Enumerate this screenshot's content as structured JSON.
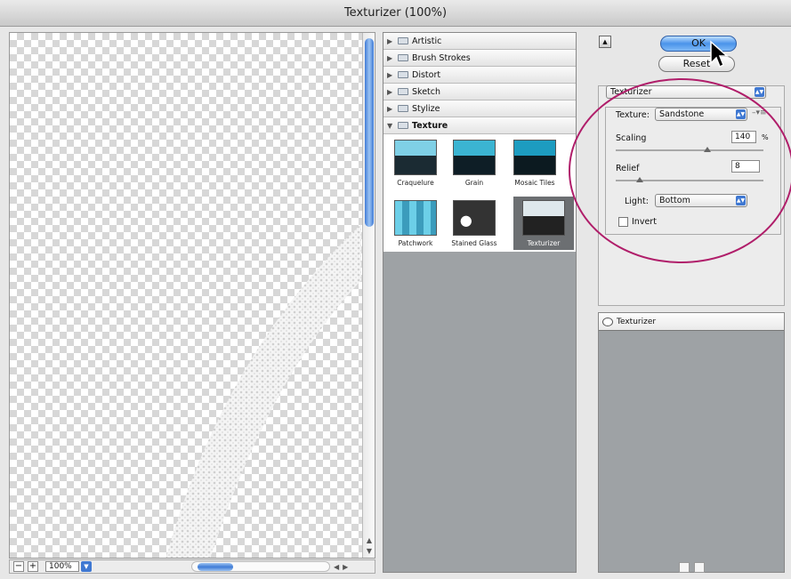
{
  "window": {
    "title": "Texturizer (100%)"
  },
  "preview": {
    "zoom": "100%",
    "zoom_out": "−",
    "zoom_in": "+"
  },
  "filters": {
    "categories": [
      {
        "label": "Artistic"
      },
      {
        "label": "Brush Strokes"
      },
      {
        "label": "Distort"
      },
      {
        "label": "Sketch"
      },
      {
        "label": "Stylize"
      },
      {
        "label": "Texture"
      }
    ],
    "thumbnails": [
      {
        "label": "Craquelure"
      },
      {
        "label": "Grain"
      },
      {
        "label": "Mosaic Tiles"
      },
      {
        "label": "Patchwork"
      },
      {
        "label": "Stained Glass"
      },
      {
        "label": "Texturizer"
      }
    ],
    "selected": "Texturizer"
  },
  "buttons": {
    "ok": "OK",
    "reset": "Reset"
  },
  "settings": {
    "filter_select": "Texturizer",
    "texture_label": "Texture:",
    "texture_value": "Sandstone",
    "scaling_label": "Scaling",
    "scaling_value": "140",
    "scaling_unit": "%",
    "scaling_percent": 0.62,
    "relief_label": "Relief",
    "relief_value": "8",
    "relief_percent": 0.16,
    "light_label": "Light:",
    "light_value": "Bottom",
    "invert_label": "Invert",
    "invert_checked": false
  },
  "layers": {
    "items": [
      {
        "label": "Texturizer"
      }
    ]
  },
  "colors": {
    "highlight_circle": "#b01e6a",
    "accent": "#3f78d2",
    "panel_bg": "#9ea2a5"
  }
}
